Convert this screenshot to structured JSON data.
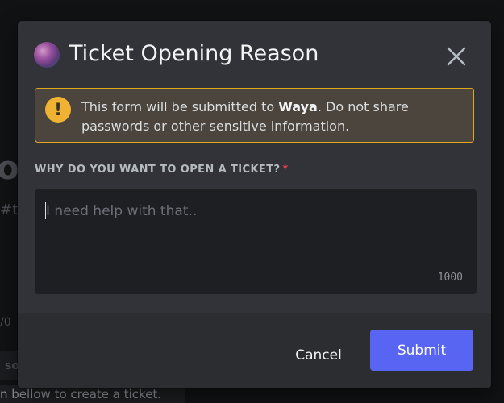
{
  "background": {
    "letter": "o",
    "hash": "#t",
    "date": "/0",
    "strip_text": "so",
    "bottom_text": "n bellow to create a ticket."
  },
  "modal": {
    "title": "Ticket Opening Reason",
    "avatar_icon": "server-avatar",
    "close_icon": "close-icon",
    "warning": {
      "icon": "exclamation-icon",
      "text_before": "This form will be submitted to ",
      "bold_name": "Waya",
      "text_after": ". Do not share passwords or other sensitive information."
    },
    "field": {
      "label": "WHY DO YOU WANT TO OPEN A TICKET?",
      "required_mark": "*",
      "placeholder": "I need help with that..",
      "value": "",
      "char_limit": "1000"
    },
    "buttons": {
      "cancel": "Cancel",
      "submit": "Submit"
    }
  },
  "colors": {
    "accent": "#5865f2",
    "warning_border": "#e0a91b",
    "warning_icon": "#f0b232",
    "required": "#f23f43"
  }
}
